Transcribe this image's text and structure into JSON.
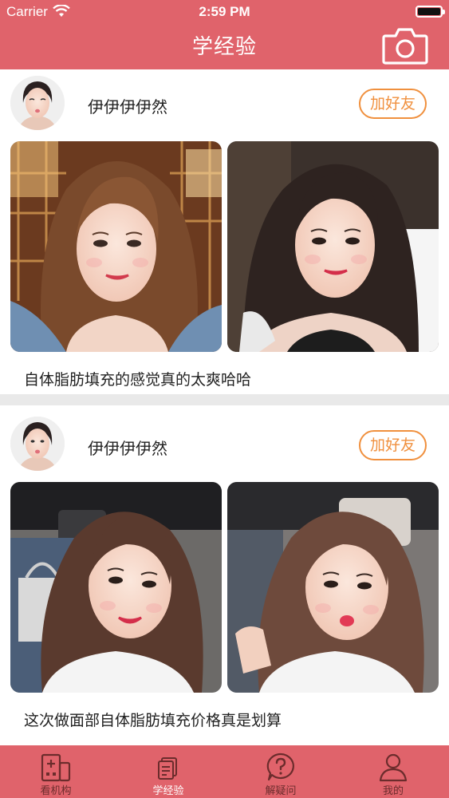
{
  "status_bar": {
    "carrier": "Carrier",
    "time": "2:59 PM"
  },
  "nav": {
    "title": "学经验",
    "camera_icon": "camera-icon"
  },
  "posts": [
    {
      "username": "伊伊伊伊然",
      "add_friend_label": "加好友",
      "caption": "自体脂肪填充的感觉真的太爽哈哈"
    },
    {
      "username": "伊伊伊伊然",
      "add_friend_label": "加好友",
      "caption": "这次做面部自体脂肪填充价格真是划算"
    }
  ],
  "tabs": [
    {
      "label": "看机构",
      "icon": "hospital-icon",
      "active": false
    },
    {
      "label": "学经验",
      "icon": "notes-icon",
      "active": true
    },
    {
      "label": "解疑问",
      "icon": "question-icon",
      "active": false
    },
    {
      "label": "我的",
      "icon": "user-icon",
      "active": false
    }
  ],
  "colors": {
    "primary": "#e0636b",
    "accent": "#f0903e",
    "text": "#222222"
  }
}
